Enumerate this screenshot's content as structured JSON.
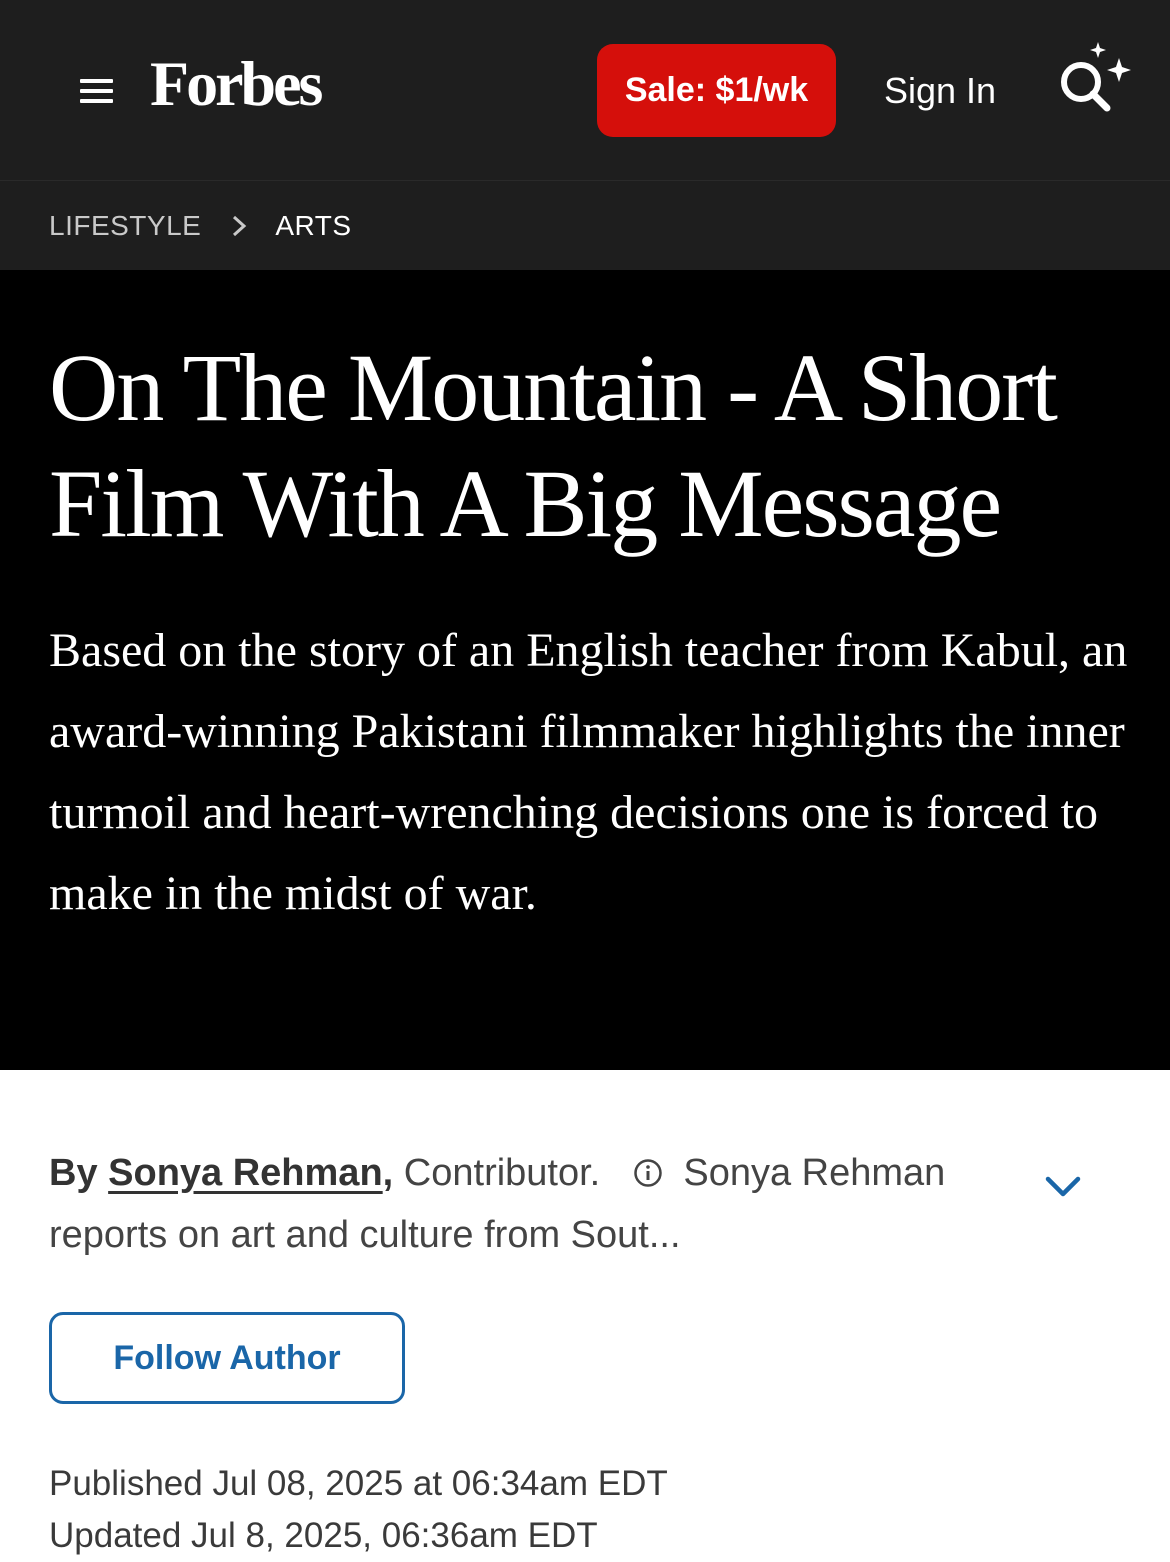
{
  "header": {
    "logo": "Forbes",
    "sale_label": "Sale: $1/wk",
    "sign_in_label": "Sign In"
  },
  "breadcrumb": {
    "section": "LIFESTYLE",
    "subsection": "ARTS"
  },
  "article": {
    "headline": "On The Mountain - A Short Film With A Big Message",
    "dek": "Based on the story of an English teacher from Kabul, an award-winning Pakistani filmmaker highlights the inner turmoil and heart-wrenching decisions one is forced to make in the midst of war."
  },
  "byline": {
    "by": "By",
    "author": "Sonya Rehman",
    "comma": ",",
    "role": "Contributor.",
    "bio": "Sonya Rehman reports on art and culture from Sout..."
  },
  "follow_label": "Follow Author",
  "dates": {
    "published": "Published Jul 08, 2025 at 06:34am EDT",
    "updated": "Updated Jul 8, 2025, 06:36am EDT"
  },
  "colors": {
    "sale_red": "#d50f0b",
    "link_blue": "#1a66a8",
    "header_bg": "#1e1e1e"
  },
  "icons": [
    "menu-icon",
    "search-sparkle-icon",
    "chevron-right-icon",
    "info-icon",
    "chevron-down-icon"
  ]
}
